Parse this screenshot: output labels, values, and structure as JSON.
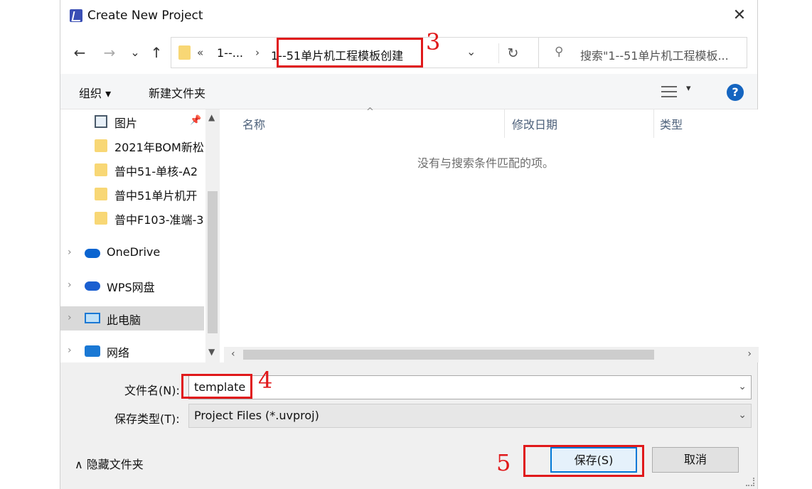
{
  "dialog": {
    "title": "Create New Project",
    "close_glyph": "✕"
  },
  "nav": {
    "back": "←",
    "forward": "→",
    "recent": "⌄",
    "up": "↑",
    "breadcrumb_overflow": "«",
    "crumb_1": "1--...",
    "crumb_2": "1--51单片机工程模板创建",
    "sep": "›",
    "dropdown": "⌄",
    "refresh": "↻",
    "search_placeholder": "搜索\"1--51单片机工程模板..."
  },
  "toolbar": {
    "organize": "组织 ▾",
    "new_folder": "新建文件夹",
    "view_dropdown": "▾",
    "help": "?"
  },
  "sidebar": {
    "items": [
      {
        "label": "图片",
        "pinned": true
      },
      {
        "label": "2021年BOM新松"
      },
      {
        "label": "普中51-单核-A2"
      },
      {
        "label": "普中51单片机开"
      },
      {
        "label": "普中F103-准端-3"
      },
      {
        "label": "OneDrive"
      },
      {
        "label": "WPS网盘"
      },
      {
        "label": "此电脑"
      },
      {
        "label": "网络"
      }
    ]
  },
  "filelist": {
    "columns": [
      "名称",
      "修改日期",
      "类型"
    ],
    "empty_message": "没有与搜索条件匹配的项。"
  },
  "form": {
    "filename_label": "文件名(N):",
    "filename_value": "template",
    "filetype_label": "保存类型(T):",
    "filetype_value": "Project Files (*.uvproj)"
  },
  "footer": {
    "hide_folders": "∧  隐藏文件夹",
    "save_button": "保存(S)",
    "cancel_button": "取消"
  },
  "annotations": {
    "step3": "3",
    "step4": "4",
    "step5": "5",
    "color": "#e0191b"
  }
}
